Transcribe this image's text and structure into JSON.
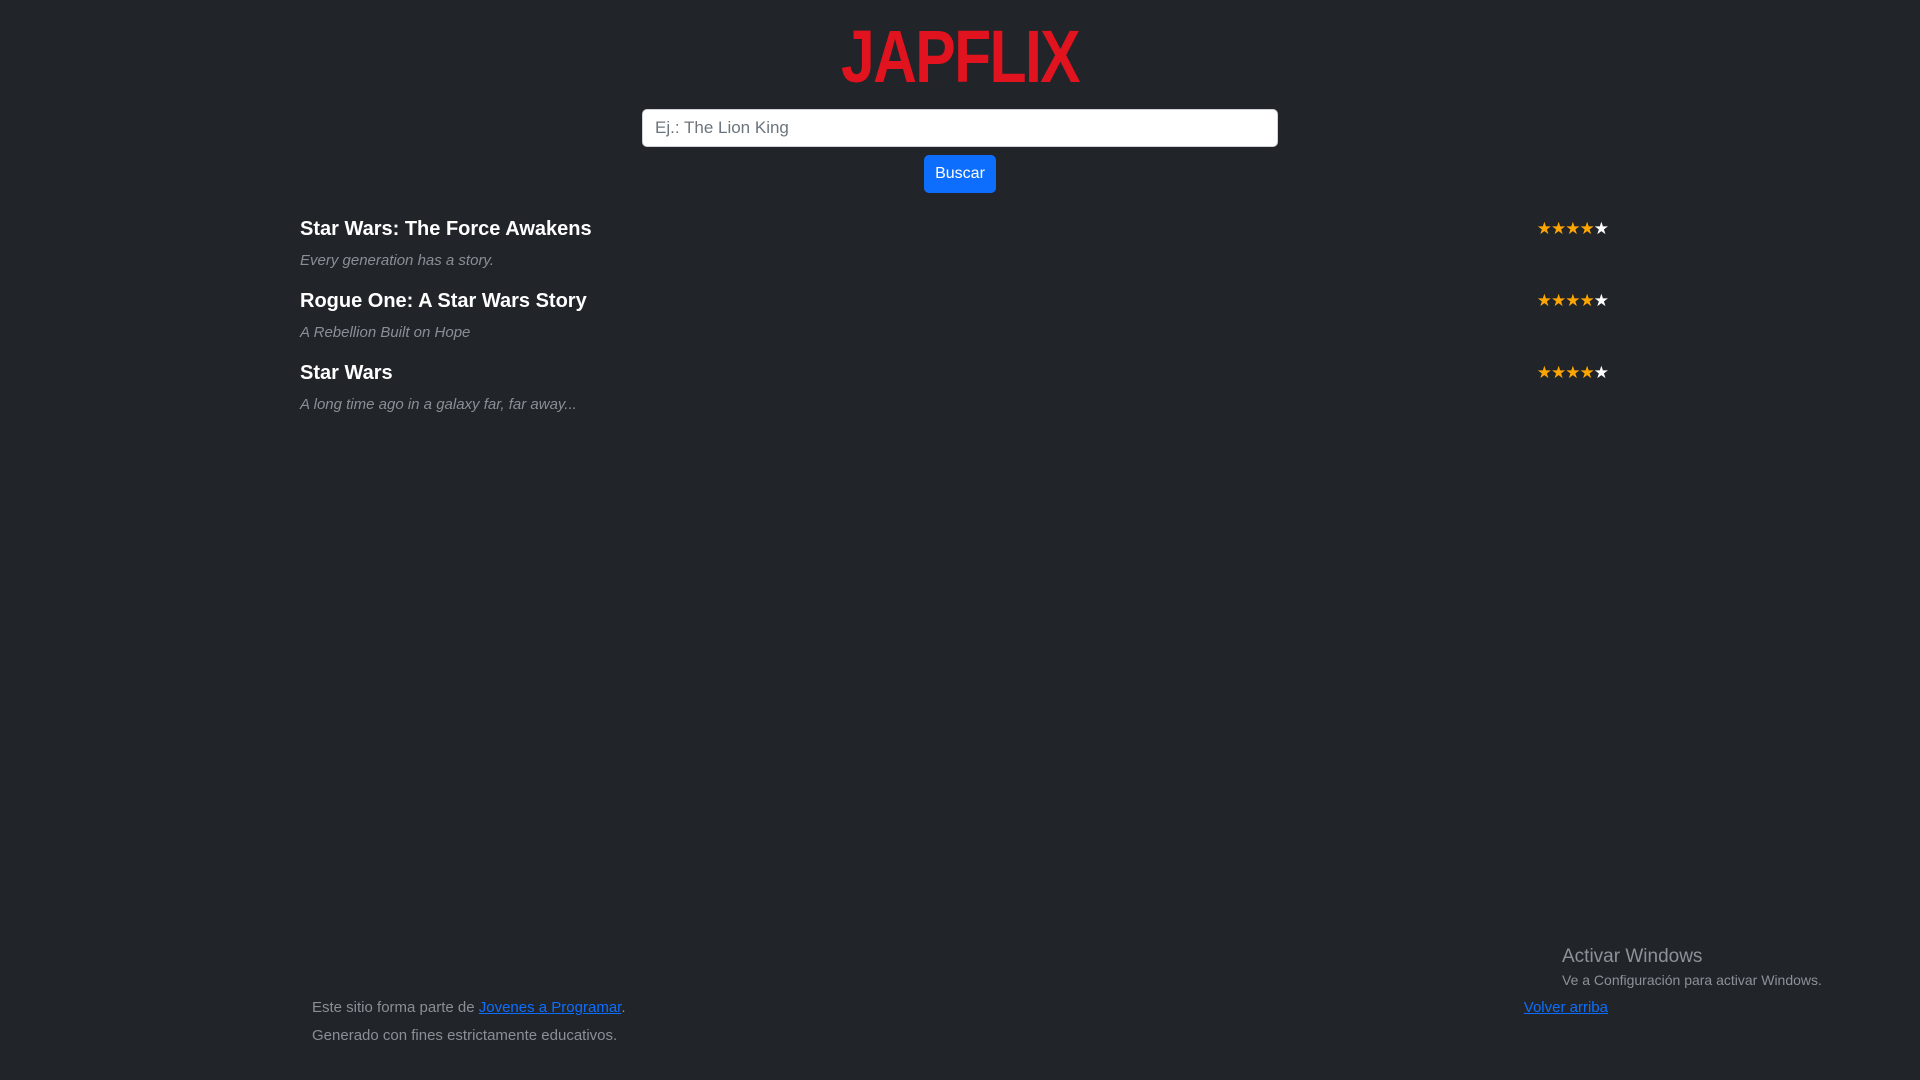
{
  "header": {
    "logo_text": "JAPFLIX"
  },
  "search": {
    "placeholder": "Ej.: The Lion King",
    "value": "",
    "button_label": "Buscar"
  },
  "results": [
    {
      "title": "Star Wars: The Force Awakens",
      "tagline": "Every generation has a story.",
      "rating": {
        "filled": 4,
        "total": 5
      }
    },
    {
      "title": "Rogue One: A Star Wars Story",
      "tagline": "A Rebellion Built on Hope",
      "rating": {
        "filled": 4,
        "total": 5
      }
    },
    {
      "title": "Star Wars",
      "tagline": "A long time ago in a galaxy far, far away...",
      "rating": {
        "filled": 4,
        "total": 5
      }
    }
  ],
  "footer": {
    "text_before_link": "Este sitio forma parte de ",
    "link_text": "Jovenes a Programar",
    "text_after_link": ".",
    "line2": "Generado con fines estrictamente educativos.",
    "back_to_top": "Volver arriba"
  },
  "watermark": {
    "title": "Activar Windows",
    "subtitle": "Ve a Configuración para activar Windows."
  },
  "colors": {
    "background": "#212429",
    "logo": "#e0131f",
    "button": "#0d6efd",
    "star_filled": "#ffa500",
    "star_empty": "#ffffff",
    "muted_text": "#8a8f96"
  },
  "icons": {
    "star_filled": "star-filled-icon",
    "star_empty": "star-empty-icon"
  }
}
